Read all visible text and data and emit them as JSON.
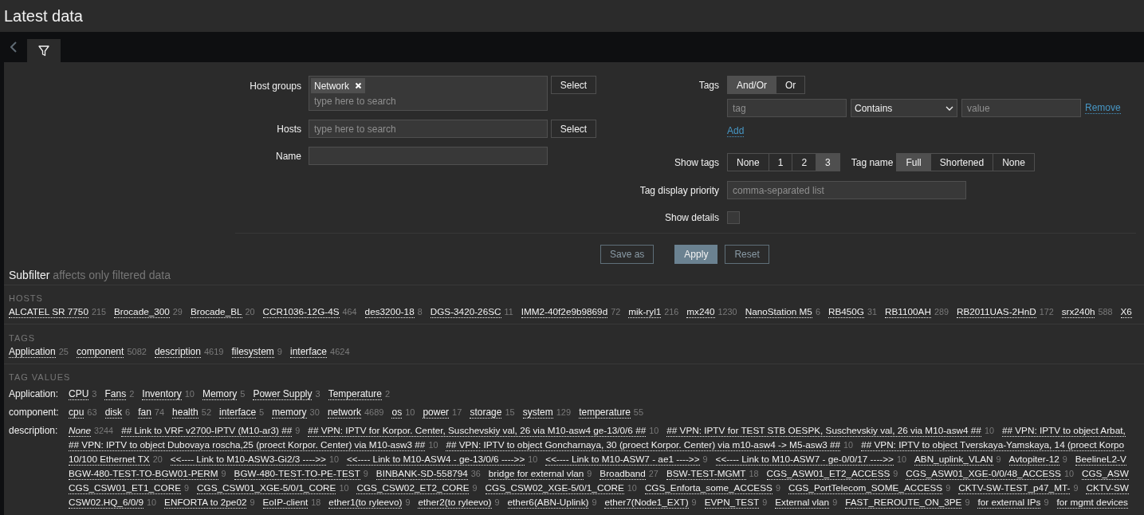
{
  "page_title": "Latest data",
  "filter": {
    "host_groups": {
      "label": "Host groups",
      "chips": [
        "Network"
      ],
      "placeholder": "type here to search",
      "button": "Select"
    },
    "hosts": {
      "label": "Hosts",
      "placeholder": "type here to search",
      "button": "Select"
    },
    "name": {
      "label": "Name"
    },
    "tags": {
      "label": "Tags",
      "operators": [
        {
          "label": "And/Or",
          "selected": true
        },
        {
          "label": "Or",
          "selected": false
        }
      ],
      "rows": [
        {
          "tag_placeholder": "tag",
          "operator": "Contains",
          "value_placeholder": "value",
          "remove": "Remove"
        }
      ],
      "add": "Add"
    },
    "show_tags": {
      "label": "Show tags",
      "options": [
        {
          "label": "None",
          "selected": false
        },
        {
          "label": "1",
          "selected": false
        },
        {
          "label": "2",
          "selected": false
        },
        {
          "label": "3",
          "selected": true
        }
      ]
    },
    "tag_name": {
      "label": "Tag name",
      "options": [
        {
          "label": "Full",
          "selected": true
        },
        {
          "label": "Shortened",
          "selected": false
        },
        {
          "label": "None",
          "selected": false
        }
      ]
    },
    "tag_display_priority": {
      "label": "Tag display priority",
      "placeholder": "comma-separated list"
    },
    "show_details": {
      "label": "Show details",
      "checked": false
    },
    "buttons": [
      {
        "label": "Save as",
        "kind": "secondary"
      },
      {
        "label": "Apply",
        "kind": "primary"
      },
      {
        "label": "Reset",
        "kind": "secondary"
      }
    ]
  },
  "subfilter": {
    "title": "Subfilter",
    "note": "affects only filtered data",
    "hosts": {
      "heading": "HOSTS",
      "items": [
        {
          "label": "ALCATEL SR 7750",
          "count": "215"
        },
        {
          "label": "Brocade_300",
          "count": "29"
        },
        {
          "label": "Brocade_BL",
          "count": "20"
        },
        {
          "label": "CCR1036-12G-4S",
          "count": "464"
        },
        {
          "label": "des3200-18",
          "count": "8"
        },
        {
          "label": "DGS-3420-26SC",
          "count": "11"
        },
        {
          "label": "IMM2-40f2e9b9869d",
          "count": "72"
        },
        {
          "label": "mik-ryl1",
          "count": "216"
        },
        {
          "label": "mx240",
          "count": "1230"
        },
        {
          "label": "NanoStation M5",
          "count": "6"
        },
        {
          "label": "RB450G",
          "count": "31"
        },
        {
          "label": "RB1100AH",
          "count": "289"
        },
        {
          "label": "RB2011UAS-2HnD",
          "count": "172"
        },
        {
          "label": "srx240h",
          "count": "588"
        },
        {
          "label": "X6"
        }
      ]
    },
    "tags": {
      "heading": "TAGS",
      "items": [
        {
          "label": "Application",
          "count": "25"
        },
        {
          "label": "component",
          "count": "5082"
        },
        {
          "label": "description",
          "count": "4619"
        },
        {
          "label": "filesystem",
          "count": "9"
        },
        {
          "label": "interface",
          "count": "4624"
        }
      ]
    },
    "tag_values": {
      "heading": "TAG VALUES",
      "groups": [
        {
          "name": "Application:",
          "lines": [
            [
              {
                "label": "CPU",
                "count": "3"
              },
              {
                "label": "Fans",
                "count": "2"
              },
              {
                "label": "Inventory",
                "count": "10"
              },
              {
                "label": "Memory",
                "count": "5"
              },
              {
                "label": "Power Supply",
                "count": "3"
              },
              {
                "label": "Temperature",
                "count": "2"
              }
            ]
          ]
        },
        {
          "name": "component:",
          "lines": [
            [
              {
                "label": "cpu",
                "count": "63"
              },
              {
                "label": "disk",
                "count": "6"
              },
              {
                "label": "fan",
                "count": "74"
              },
              {
                "label": "health",
                "count": "52"
              },
              {
                "label": "interface",
                "count": "5"
              },
              {
                "label": "memory",
                "count": "30"
              },
              {
                "label": "network",
                "count": "4689"
              },
              {
                "label": "os",
                "count": "10"
              },
              {
                "label": "power",
                "count": "17"
              },
              {
                "label": "storage",
                "count": "15"
              },
              {
                "label": "system",
                "count": "129"
              },
              {
                "label": "temperature",
                "count": "55"
              }
            ]
          ]
        },
        {
          "name": "description:",
          "lines": [
            [
              {
                "label": "None",
                "count": "3244",
                "italic": true
              },
              {
                "label": "## Link to VRF v2700-IPTV (M10-ar3) ##",
                "count": "9"
              },
              {
                "label": "## VPN: IPTV for Korpor. Center, Suschevskiy val, 26 via M10-asw4 ge-13/0/6 ##",
                "count": "10"
              },
              {
                "label": "## VPN: IPTV for TEST STB OESPK, Suschevskiy val, 26 via M10-asw4 ##",
                "count": "10"
              },
              {
                "label": "## VPN: IPTV to object Arbat,"
              }
            ],
            [
              {
                "label": "## VPN: IPTV to object Dubovaya roscha,25 (proect Korpor. Center) via M10-asw3 ##",
                "count": "10"
              },
              {
                "label": "## VPN: IPTV to object Goncharnaya, 30 (proect Korpor. Center) via m10-asw4 -> M5-asw3 ##",
                "count": "10"
              },
              {
                "label": "## VPN: IPTV to object Tverskaya-Yamskaya, 14 (proect Korpo"
              }
            ],
            [
              {
                "label": "10/100 Ethernet TX",
                "count": "20"
              },
              {
                "label": "<<---- Link to M10-ASW3-Gi2/3 ---->>",
                "count": "10"
              },
              {
                "label": "<<---- Link to M10-ASW4 - ge-13/0/6 ---->>",
                "count": "10"
              },
              {
                "label": "<<---- Link to M10-ASW7 - ae1 ---->>",
                "count": "9"
              },
              {
                "label": "<<---- Link to M10-ASW7 - ge-0/0/17 ---->>",
                "count": "10"
              },
              {
                "label": "ABN_uplink_VLAN",
                "count": "9"
              },
              {
                "label": "Avtopiter-12",
                "count": "9"
              },
              {
                "label": "BeelineL2-V"
              }
            ],
            [
              {
                "label": "BGW-480-TEST-TO-BGW01-PERM",
                "count": "9"
              },
              {
                "label": "BGW-480-TEST-TO-PE-TEST",
                "count": "9"
              },
              {
                "label": "BINBANK-SD-558794",
                "count": "36"
              },
              {
                "label": "bridge for external vlan",
                "count": "9"
              },
              {
                "label": "Broadband",
                "count": "27"
              },
              {
                "label": "BSW-TEST-MGMT",
                "count": "18"
              },
              {
                "label": "CGS_ASW01_ET2_ACCESS",
                "count": "9"
              },
              {
                "label": "CGS_ASW01_XGE-0/0/48_ACCESS",
                "count": "10"
              },
              {
                "label": "CGS_ASW"
              }
            ],
            [
              {
                "label": "CGS_CSW01_ET1_CORE",
                "count": "9"
              },
              {
                "label": "CGS_CSW01_XGE-5/0/1_CORE",
                "count": "10"
              },
              {
                "label": "CGS_CSW02_ET2_CORE",
                "count": "9"
              },
              {
                "label": "CGS_CSW02_XGE-5/0/1_CORE",
                "count": "10"
              },
              {
                "label": "CGS_Enforta_some_ACCESS",
                "count": "9"
              },
              {
                "label": "CGS_PortTelecom_SOME_ACCESS",
                "count": "9"
              },
              {
                "label": "CKTV-SW-TEST_p47_MT-",
                "count": "9"
              },
              {
                "label": "CKTV-SW"
              }
            ],
            [
              {
                "label": "CSW02.HQ_6/0/9",
                "count": "10"
              },
              {
                "label": "ENFORTA to 2pe02",
                "count": "9"
              },
              {
                "label": "EoIP-client",
                "count": "18"
              },
              {
                "label": "ether1(to ryleevo)",
                "count": "9"
              },
              {
                "label": "ether2(to ryleevo)",
                "count": "9"
              },
              {
                "label": "ether6(ABN-Uplink)",
                "count": "9"
              },
              {
                "label": "ether7(Node1_EXT)",
                "count": "9"
              },
              {
                "label": "EVPN_TEST",
                "count": "9"
              },
              {
                "label": "External vlan",
                "count": "9"
              },
              {
                "label": "FAST_REROUTE_ON_3PE",
                "count": "9"
              },
              {
                "label": "for external IPs",
                "count": "9"
              },
              {
                "label": "for mgmt devices"
              }
            ]
          ]
        }
      ]
    }
  }
}
